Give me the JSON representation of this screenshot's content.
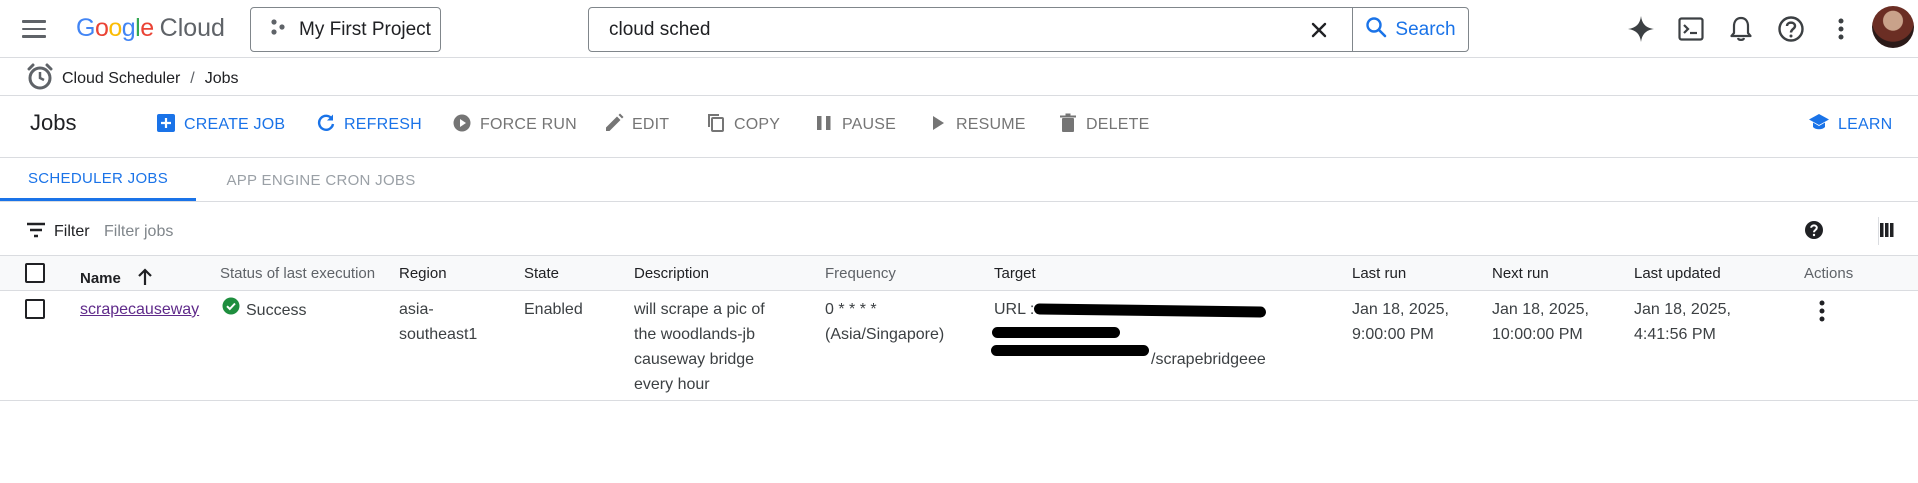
{
  "header": {
    "logo_google": "Google",
    "logo_cloud": "Cloud",
    "project": "My First Project",
    "search": {
      "value": "cloud sched",
      "button": "Search"
    },
    "icons": [
      "gemini-icon",
      "cloud-shell-icon",
      "notifications-icon",
      "help-icon",
      "more-vert-icon"
    ]
  },
  "breadcrumb": {
    "service": "Cloud Scheduler",
    "separator": "/",
    "page": "Jobs"
  },
  "toolbar": {
    "title": "Jobs",
    "create": "CREATE JOB",
    "refresh": "REFRESH",
    "force_run": "FORCE RUN",
    "edit": "EDIT",
    "copy": "COPY",
    "pause": "PAUSE",
    "resume": "RESUME",
    "delete": "DELETE",
    "learn": "LEARN"
  },
  "tabs": [
    {
      "label": "SCHEDULER JOBS",
      "active": true
    },
    {
      "label": "APP ENGINE CRON JOBS",
      "active": false
    }
  ],
  "filter": {
    "label": "Filter",
    "placeholder": "Filter jobs"
  },
  "table": {
    "columns": [
      "Name",
      "Status of last execution",
      "Region",
      "State",
      "Description",
      "Frequency",
      "Target",
      "Last run",
      "Next run",
      "Last updated",
      "Actions"
    ],
    "rows": [
      {
        "name": "scrapecauseway",
        "status": "Success",
        "region_line1": "asia-",
        "region_line2": "southeast1",
        "state": "Enabled",
        "desc_line1": "will scrape a pic of",
        "desc_line2": "the woodlands-jb",
        "desc_line3": "causeway bridge",
        "desc_line4": "every hour",
        "freq_line1": "0 * * * *",
        "freq_line2": "(Asia/Singapore)",
        "target_prefix": "URL : ",
        "target_suffix": "/scrapebridgeee",
        "last_run_line1": "Jan 18, 2025,",
        "last_run_line2": "9:00:00 PM",
        "next_run_line1": "Jan 18, 2025,",
        "next_run_line2": "10:00:00 PM",
        "updated_line1": "Jan 18, 2025,",
        "updated_line2": "4:41:56 PM"
      }
    ]
  },
  "colors": {
    "accent": "#1a73e8",
    "success": "#1e8e3e",
    "link_visited": "#5f2a8a"
  }
}
